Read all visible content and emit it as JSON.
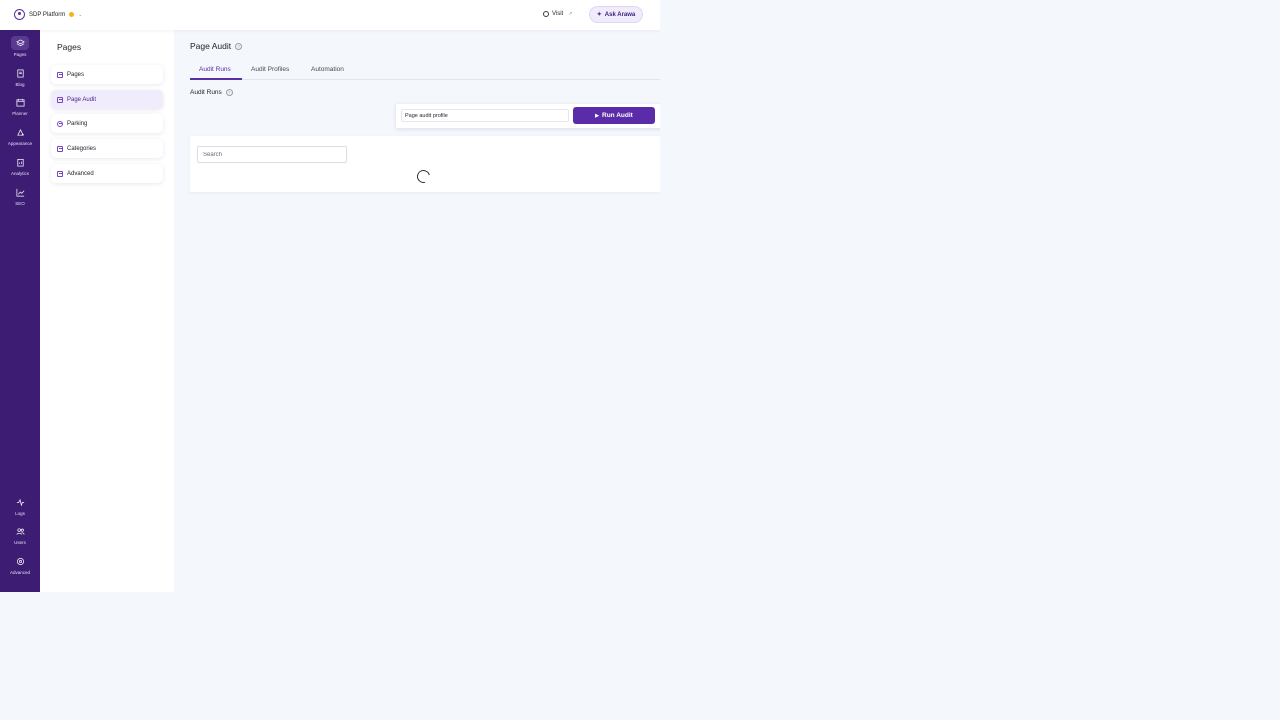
{
  "topbar": {
    "brand_name": "SDP Platform",
    "visit_label": "Visit",
    "ask_label": "Ask Arawa"
  },
  "rail": {
    "top_items": [
      {
        "label": "Pages",
        "icon": "layers-icon",
        "active": true
      },
      {
        "label": "Blog",
        "icon": "document-icon"
      },
      {
        "label": "Planner",
        "icon": "calendar-icon"
      },
      {
        "label": "Appearance",
        "icon": "brush-icon"
      },
      {
        "label": "Analytics",
        "icon": "clipboard-chart-icon"
      },
      {
        "label": "SEO",
        "icon": "trend-chart-icon"
      }
    ],
    "bottom_items": [
      {
        "label": "Logs",
        "icon": "pulse-icon"
      },
      {
        "label": "Users",
        "icon": "users-icon"
      },
      {
        "label": "Advanced",
        "icon": "gear-icon"
      }
    ]
  },
  "subnav": {
    "title": "Pages",
    "items": [
      {
        "label": "Pages"
      },
      {
        "label": "Page Audit",
        "active": true
      },
      {
        "label": "Parking"
      },
      {
        "label": "Categories"
      },
      {
        "label": "Advanced"
      }
    ]
  },
  "main": {
    "title": "Page Audit",
    "tabs": [
      {
        "label": "Audit Runs",
        "active": true
      },
      {
        "label": "Audit Profiles"
      },
      {
        "label": "Automation"
      }
    ],
    "section_label": "Audit Runs",
    "profile_value": "Page audit profile",
    "run_button_label": "Run Audit",
    "search_placeholder": "Search"
  },
  "colors": {
    "accent": "#5b2ca8",
    "rail_bg": "#3d1d73",
    "status_dot": "#f5b418",
    "page_bg": "#f4f7fc"
  }
}
